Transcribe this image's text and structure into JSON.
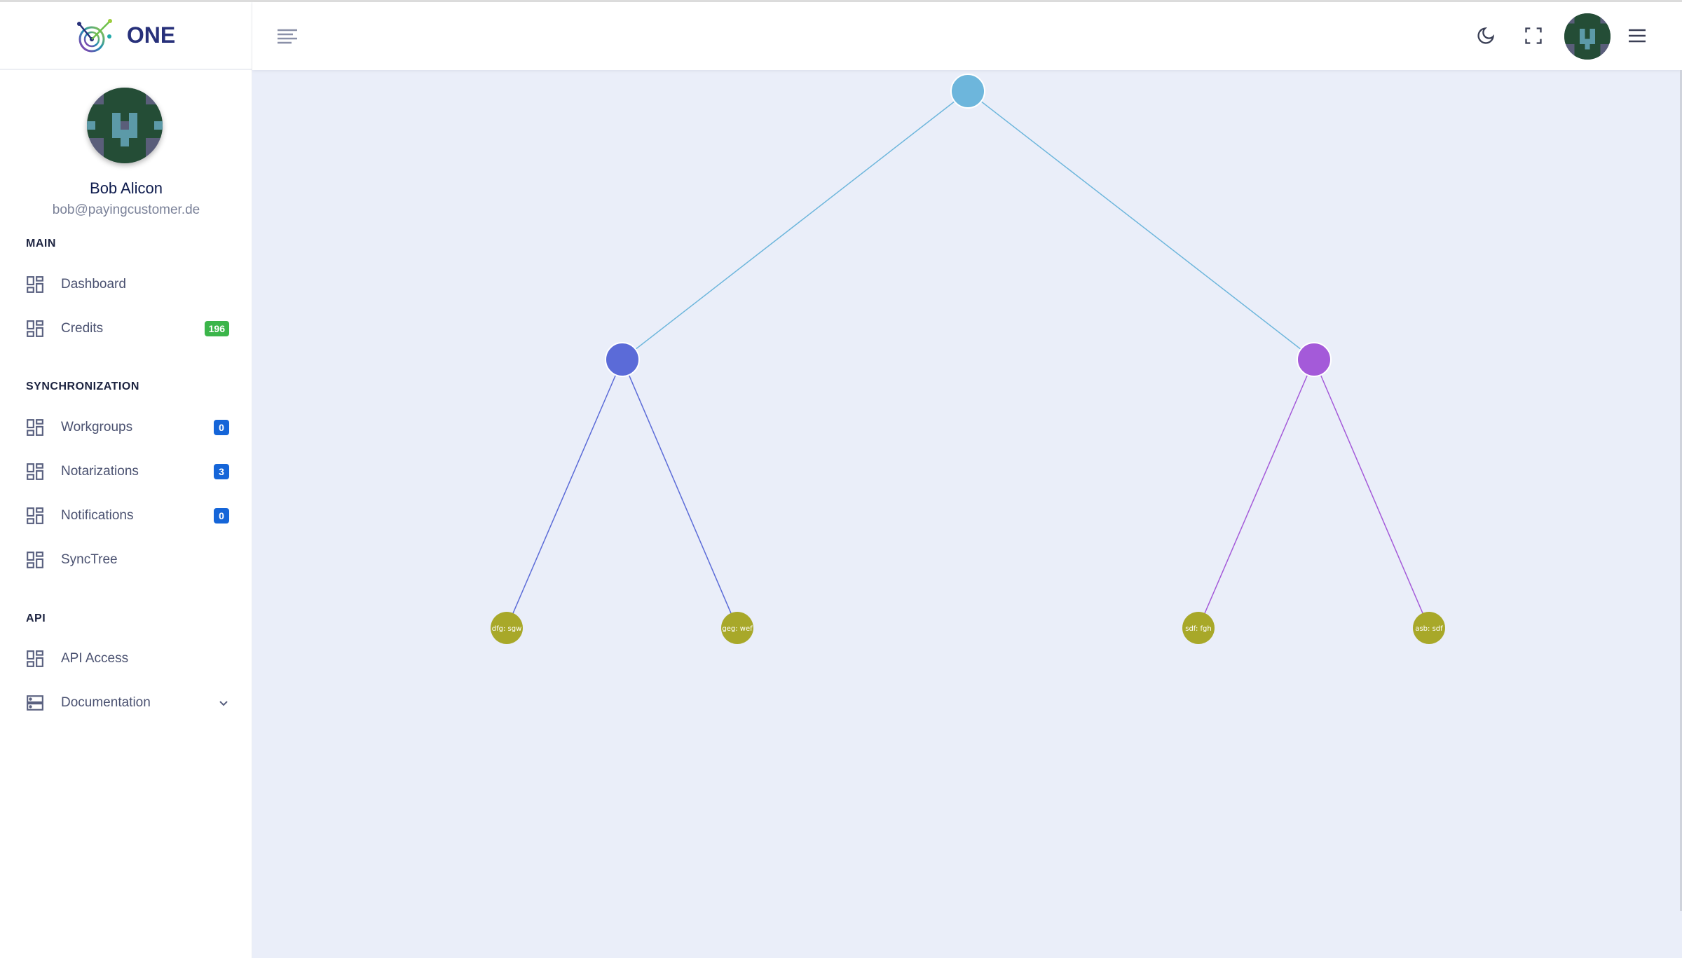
{
  "brand": {
    "name": "ONE"
  },
  "user": {
    "name": "Bob Alicon",
    "email": "bob@payingcustomer.de"
  },
  "sidebar": {
    "sections": [
      {
        "title": "MAIN",
        "items": [
          {
            "label": "Dashboard",
            "icon": "grid-icon"
          },
          {
            "label": "Credits",
            "icon": "grid-icon",
            "badge": "196",
            "badge_color": "#3bb54a"
          }
        ]
      },
      {
        "title": "SYNCHRONIZATION",
        "items": [
          {
            "label": "Workgroups",
            "icon": "grid-icon",
            "badge": "0",
            "badge_color": "#1565d8"
          },
          {
            "label": "Notarizations",
            "icon": "grid-icon",
            "badge": "3",
            "badge_color": "#1565d8"
          },
          {
            "label": "Notifications",
            "icon": "grid-icon",
            "badge": "0",
            "badge_color": "#1565d8"
          },
          {
            "label": "SyncTree",
            "icon": "grid-icon"
          }
        ]
      },
      {
        "title": "API",
        "items": [
          {
            "label": "API Access",
            "icon": "grid-icon"
          },
          {
            "label": "Documentation",
            "icon": "server-icon",
            "expandable": true
          }
        ]
      }
    ]
  },
  "header": {
    "icons": [
      "menu-lines-icon",
      "moon-icon",
      "fullscreen-icon",
      "avatar",
      "hamburger-icon"
    ]
  },
  "tree": {
    "root": {
      "color": "#6db6dc",
      "children": [
        {
          "color": "#5b6bd8",
          "children": [
            {
              "label": "dfg: sgw",
              "color": "#a8a829"
            },
            {
              "label": "geg: wef",
              "color": "#a8a829"
            }
          ]
        },
        {
          "color": "#a45ad9",
          "children": [
            {
              "label": "sdf: fgh",
              "color": "#a8a829"
            },
            {
              "label": "asb: sdf",
              "color": "#a8a829"
            }
          ]
        }
      ]
    }
  }
}
